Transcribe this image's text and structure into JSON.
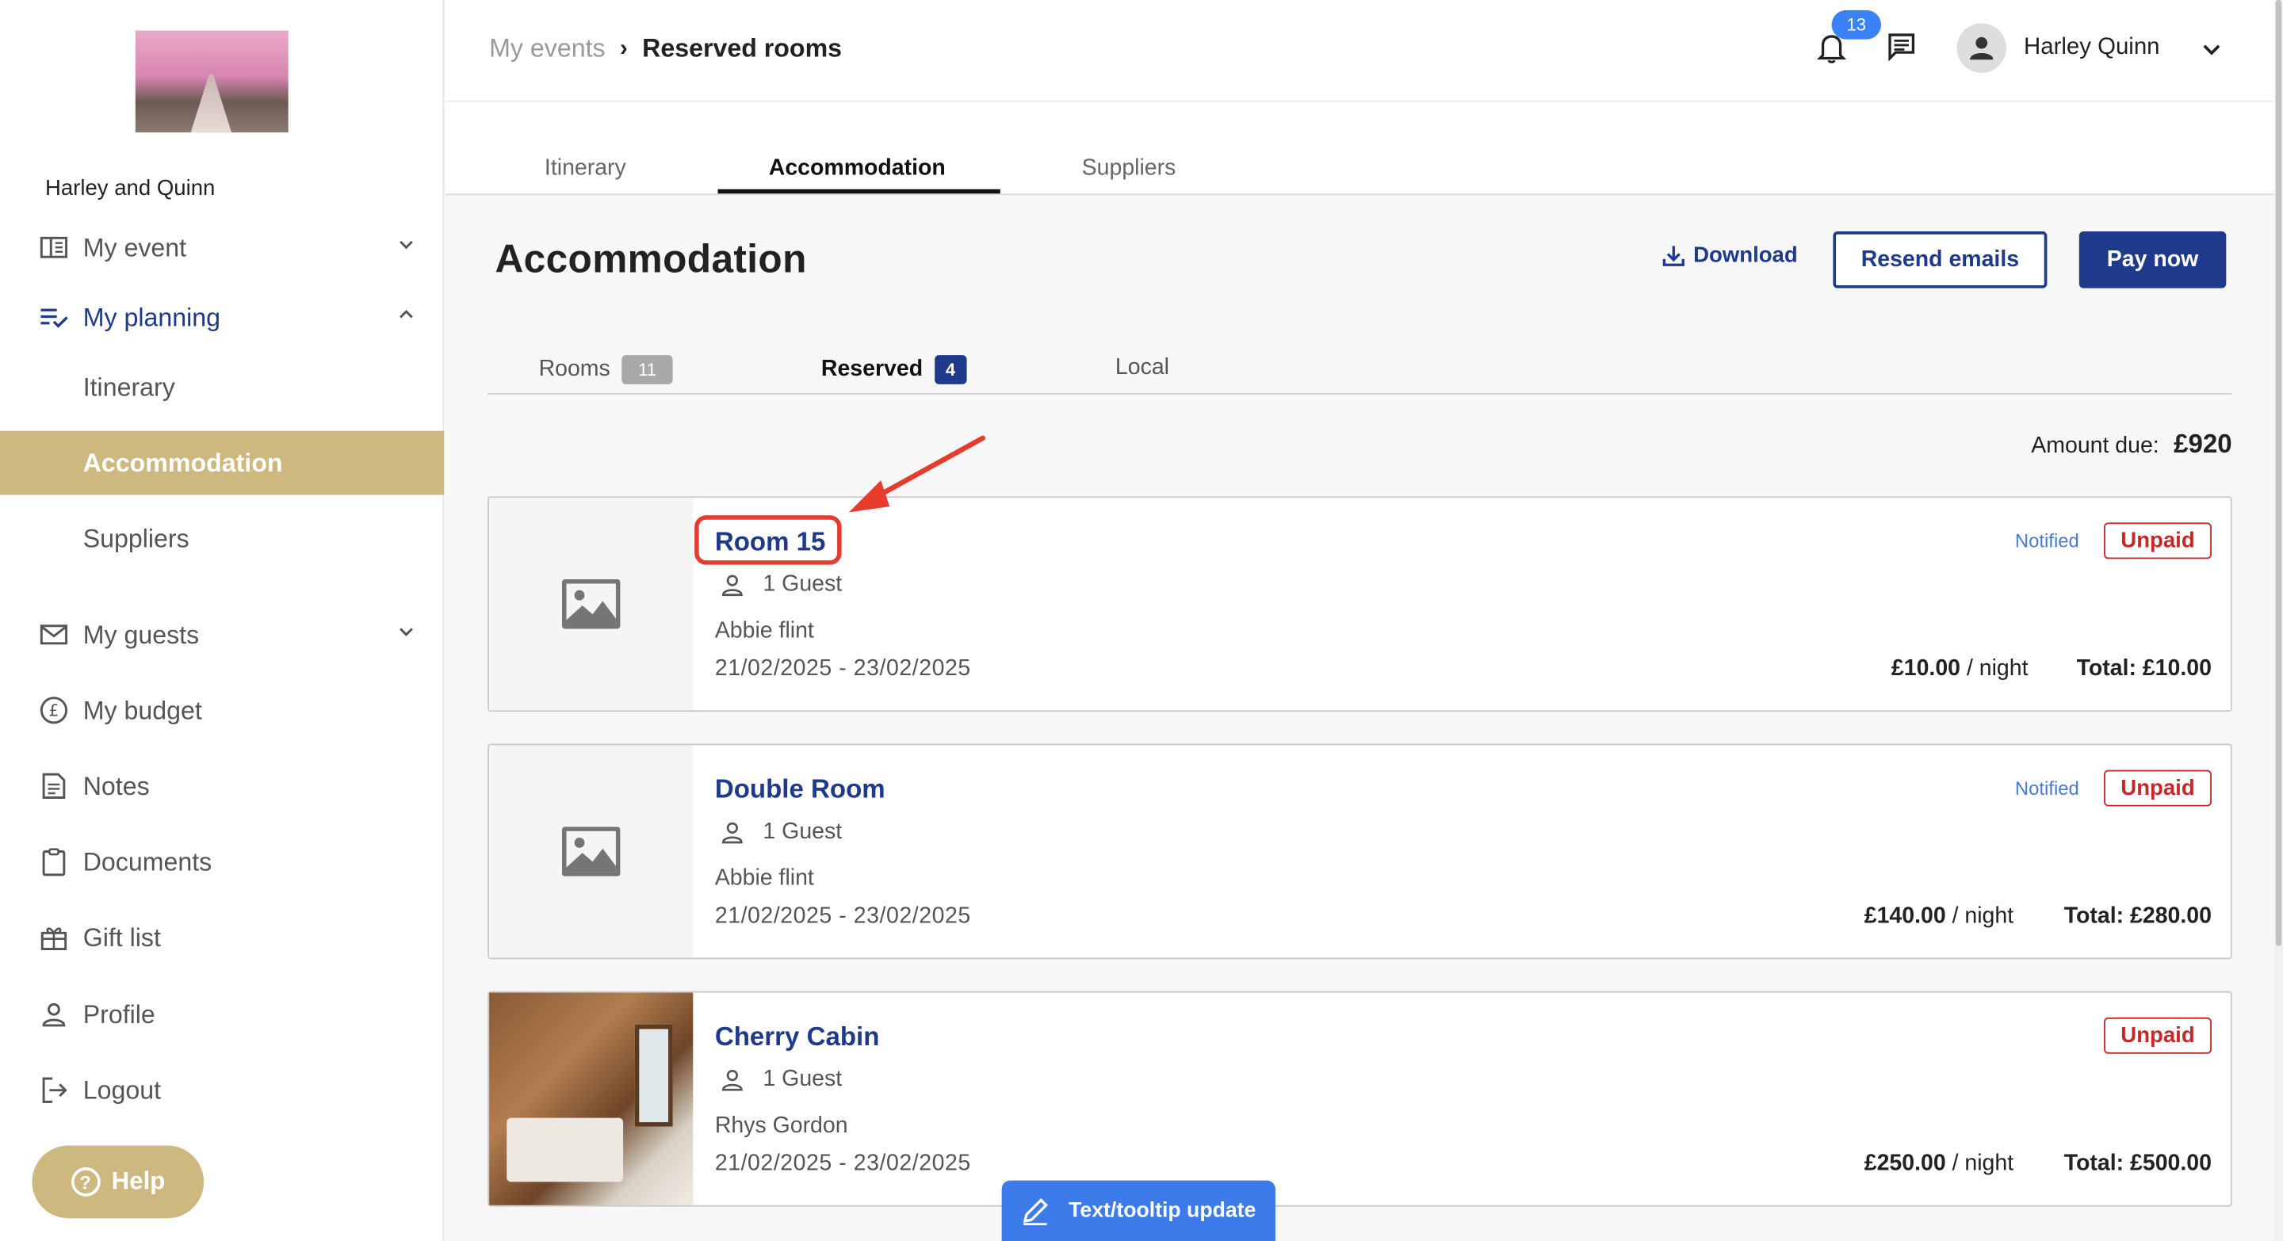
{
  "sidebar": {
    "event_name": "Harley and Quinn",
    "items": [
      {
        "label": "My event",
        "icon": "book-icon"
      },
      {
        "label": "My planning",
        "icon": "checklist-icon"
      },
      {
        "label": "My guests",
        "icon": "mail-icon"
      },
      {
        "label": "My budget",
        "icon": "pound-icon"
      },
      {
        "label": "Notes",
        "icon": "notes-icon"
      },
      {
        "label": "Documents",
        "icon": "clipboard-icon"
      },
      {
        "label": "Gift list",
        "icon": "gift-icon"
      },
      {
        "label": "Profile",
        "icon": "person-icon"
      },
      {
        "label": "Logout",
        "icon": "logout-icon"
      }
    ],
    "planning_sub": [
      "Itinerary",
      "Accommodation",
      "Suppliers"
    ],
    "help_label": "Help"
  },
  "topbar": {
    "breadcrumb_parent": "My events",
    "breadcrumb_current": "Reserved rooms",
    "notification_count": "13",
    "user_name": "Harley Quinn"
  },
  "main_tabs": [
    "Itinerary",
    "Accommodation",
    "Suppliers"
  ],
  "page": {
    "title": "Accommodation",
    "download_label": "Download",
    "resend_label": "Resend emails",
    "pay_label": "Pay now"
  },
  "sub_tabs": [
    {
      "label": "Rooms",
      "count": "11"
    },
    {
      "label": "Reserved",
      "count": "4"
    },
    {
      "label": "Local"
    }
  ],
  "amount_due": {
    "label": "Amount due:",
    "value": "£920"
  },
  "rooms": [
    {
      "name": "Room 15",
      "guests": "1 Guest",
      "guest_name": "Abbie flint",
      "dates": "21/02/2025 - 23/02/2025",
      "notified": "Notified",
      "status": "Unpaid",
      "price": "£10.00",
      "per": "/ night",
      "total": "Total: £10.00"
    },
    {
      "name": "Double Room",
      "guests": "1 Guest",
      "guest_name": "Abbie flint",
      "dates": "21/02/2025 - 23/02/2025",
      "notified": "Notified",
      "status": "Unpaid",
      "price": "£140.00",
      "per": "/ night",
      "total": "Total: £280.00"
    },
    {
      "name": "Cherry Cabin",
      "guests": "1 Guest",
      "guest_name": "Rhys Gordon",
      "dates": "21/02/2025 - 23/02/2025",
      "status": "Unpaid",
      "price": "£250.00",
      "per": "/ night",
      "total": "Total: £500.00"
    }
  ],
  "tooltip_update_label": "Text/tooltip update",
  "colors": {
    "brand_navy": "#1f3a8a",
    "gold": "#cdb97f",
    "unpaid_red": "#c62828",
    "annotation_red": "#e53c2e"
  }
}
